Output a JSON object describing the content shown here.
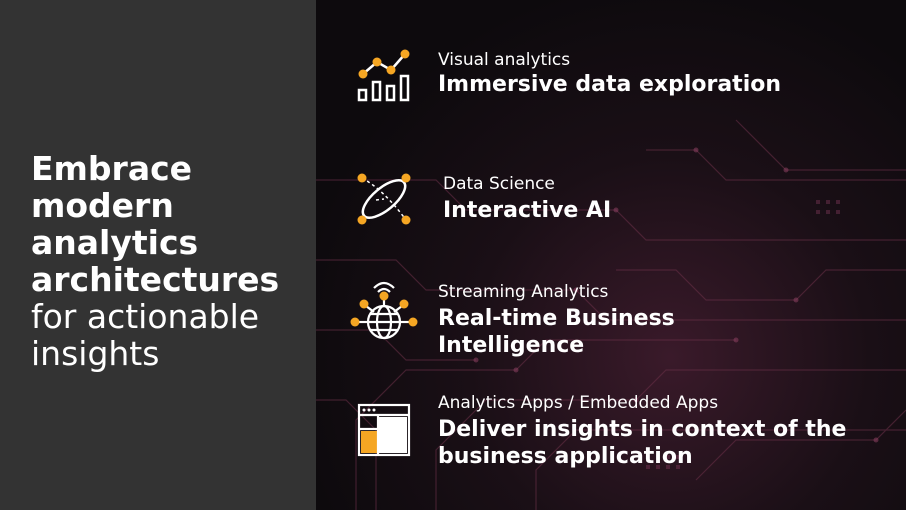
{
  "headline": {
    "line1": "Embrace",
    "line2": "modern",
    "line3": "analytics",
    "line4": "architectures",
    "line5": "for actionable",
    "line6": "insights"
  },
  "items": [
    {
      "subtitle": "Visual analytics",
      "title": "Immersive data exploration",
      "icon": "bar-chart-trend-icon"
    },
    {
      "subtitle": "Data Science",
      "title": "Interactive AI",
      "icon": "orbit-atom-icon"
    },
    {
      "subtitle": "Streaming Analytics",
      "title": "Real-time Business Intelligence",
      "icon": "globe-network-icon"
    },
    {
      "subtitle": "Analytics Apps / Embedded Apps",
      "title": "Deliver insights in context of the business application",
      "icon": "app-window-icon"
    }
  ],
  "colors": {
    "accent": "#f5a623",
    "left_panel": "#333333",
    "text": "#ffffff"
  }
}
